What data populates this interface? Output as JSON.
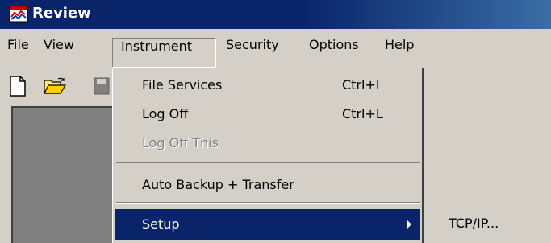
{
  "window": {
    "title": "Review"
  },
  "menubar": {
    "items": [
      {
        "label": "File"
      },
      {
        "label": "View"
      },
      {
        "label": "Instrument"
      },
      {
        "label": "Security"
      },
      {
        "label": "Options"
      },
      {
        "label": "Help"
      }
    ]
  },
  "toolbar": {
    "icons": [
      "new-document-icon",
      "open-folder-icon",
      "save-disk-icon"
    ]
  },
  "instrument_menu": {
    "items": [
      {
        "label": "File Services",
        "accel": "Ctrl+I",
        "enabled": true
      },
      {
        "label": "Log Off",
        "accel": "Ctrl+L",
        "enabled": true
      },
      {
        "label": "Log Off This",
        "accel": "",
        "enabled": false
      },
      {
        "label": "Auto Backup + Transfer",
        "accel": "",
        "enabled": true
      },
      {
        "label": "Setup",
        "accel": "",
        "enabled": true,
        "highlighted": true,
        "has_submenu": true
      }
    ]
  },
  "setup_submenu": {
    "items": [
      {
        "label": "TCP/IP..."
      }
    ]
  },
  "colors": {
    "titlebar": "#0a246a",
    "highlight": "#0a246a",
    "face": "#d4d0c8",
    "client": "#808080"
  }
}
